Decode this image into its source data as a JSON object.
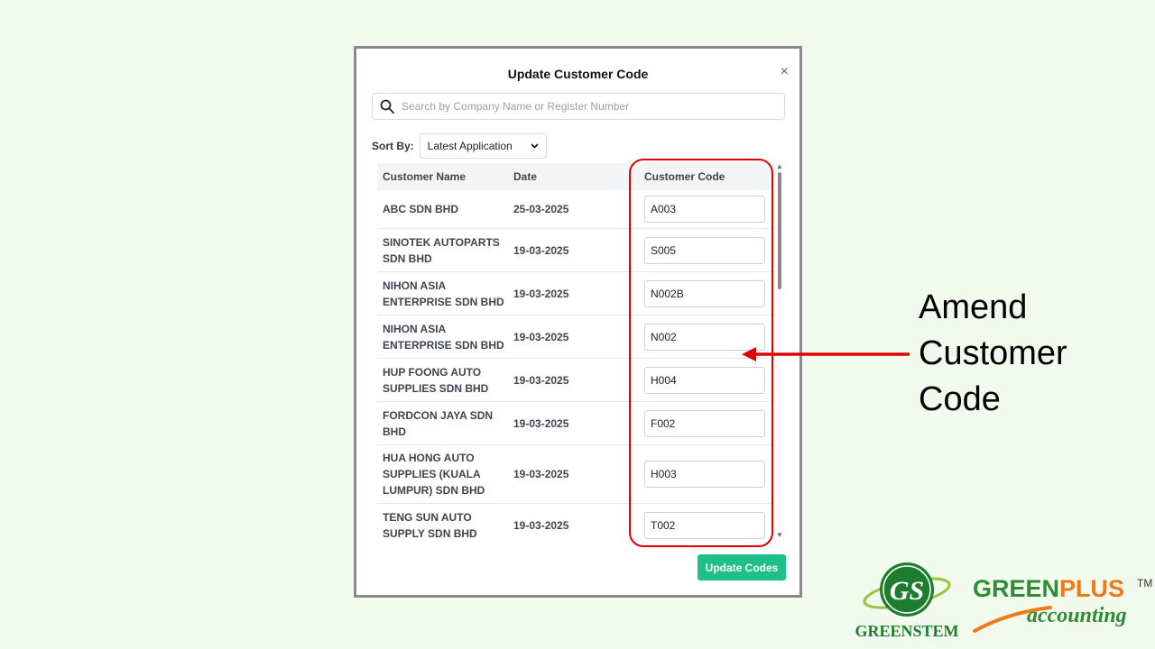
{
  "modal": {
    "title": "Update Customer Code",
    "close_symbol": "×",
    "search_placeholder": "Search by Company Name or Register Number",
    "sort_label": "Sort By:",
    "sort_value": "Latest Application",
    "columns": [
      "Customer Name",
      "Date",
      "Customer Code"
    ],
    "rows": [
      {
        "name": "ABC SDN BHD",
        "date": "25-03-2025",
        "code": "A003"
      },
      {
        "name": "SINOTEK AUTOPARTS SDN BHD",
        "date": "19-03-2025",
        "code": "S005"
      },
      {
        "name": "NIHON ASIA ENTERPRISE SDN BHD",
        "date": "19-03-2025",
        "code": "N002B"
      },
      {
        "name": "NIHON ASIA ENTERPRISE SDN BHD",
        "date": "19-03-2025",
        "code": "N002"
      },
      {
        "name": "HUP FOONG AUTO SUPPLIES SDN BHD",
        "date": "19-03-2025",
        "code": "H004"
      },
      {
        "name": "FORDCON JAYA SDN BHD",
        "date": "19-03-2025",
        "code": "F002"
      },
      {
        "name": "HUA HONG AUTO SUPPLIES (KUALA LUMPUR) SDN BHD",
        "date": "19-03-2025",
        "code": "H003"
      },
      {
        "name": "TENG SUN AUTO SUPPLY SDN BHD",
        "date": "19-03-2025",
        "code": "T002"
      }
    ],
    "update_button": "Update Codes"
  },
  "annotation": {
    "lines": [
      "Amend",
      "Customer",
      "Code"
    ],
    "color": "#e00000"
  },
  "logos": {
    "greenstem": "GREENSTEM",
    "greenstem_mark": "GS",
    "greenplus_green": "GREEN",
    "greenplus_orange": "PLUS",
    "greenplus_tm": "TM",
    "greenplus_sub": "accounting"
  },
  "colors": {
    "background": "#f2faed",
    "button": "#1fbf8a",
    "brand_green": "#2e8b36",
    "brand_orange": "#f07a1a"
  }
}
